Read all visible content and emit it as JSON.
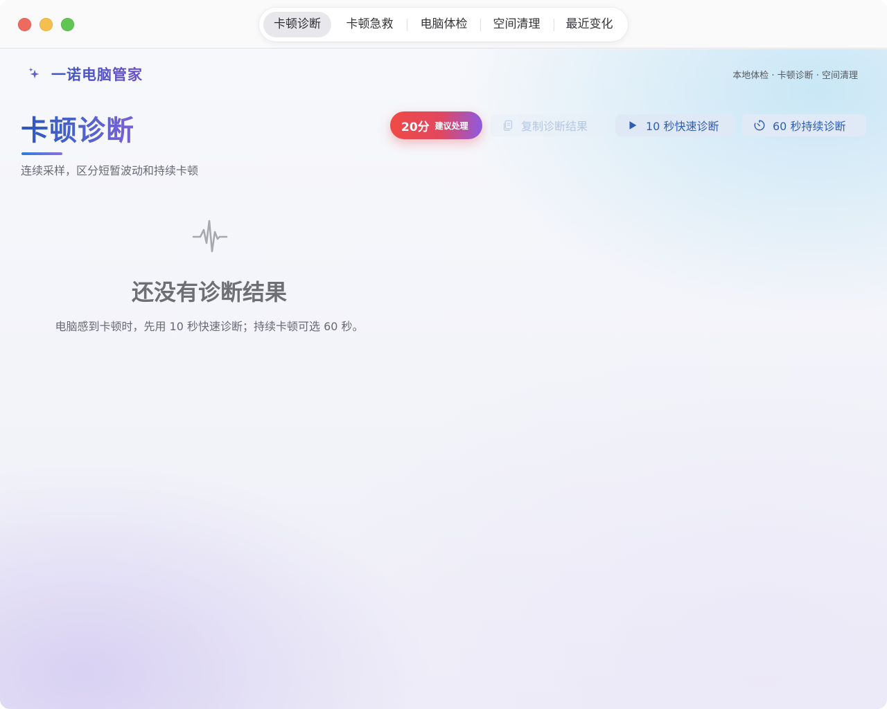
{
  "titlebar": {
    "tabs": [
      {
        "label": "卡顿诊断",
        "active": true
      },
      {
        "label": "卡顿急救",
        "active": false
      },
      {
        "label": "电脑体检",
        "active": false
      },
      {
        "label": "空间清理",
        "active": false
      },
      {
        "label": "最近变化",
        "active": false
      }
    ]
  },
  "header": {
    "app_name": "一诺电脑管家",
    "breadcrumbs": "本地体检 · 卡顿诊断 · 空间清理"
  },
  "page": {
    "title": "卡顿诊断",
    "subtitle": "连续采样，区分短暂波动和持续卡顿"
  },
  "score": {
    "value": "20分",
    "hint": "建议处理"
  },
  "actions": {
    "copy_label": "复制诊断结果",
    "quick_label": "10 秒快速诊断",
    "long_label": "60 秒持续诊断"
  },
  "empty_state": {
    "title": "还没有诊断结果",
    "description": "电脑感到卡顿时，先用 10 秒快速诊断；持续卡顿可选 60 秒。"
  },
  "colors": {
    "accent_blue": "#2f5db5",
    "score_red": "#ef4a45",
    "score_purple": "#8d5ae0",
    "traffic_red": "#ed6a5e",
    "traffic_yellow": "#f5bf4f",
    "traffic_green": "#61c554"
  },
  "icons": {
    "brand": "sparkles-icon",
    "copy": "copy-document-icon",
    "quick": "play-icon",
    "long": "timer-icon",
    "empty": "pulse-waveform-icon"
  }
}
